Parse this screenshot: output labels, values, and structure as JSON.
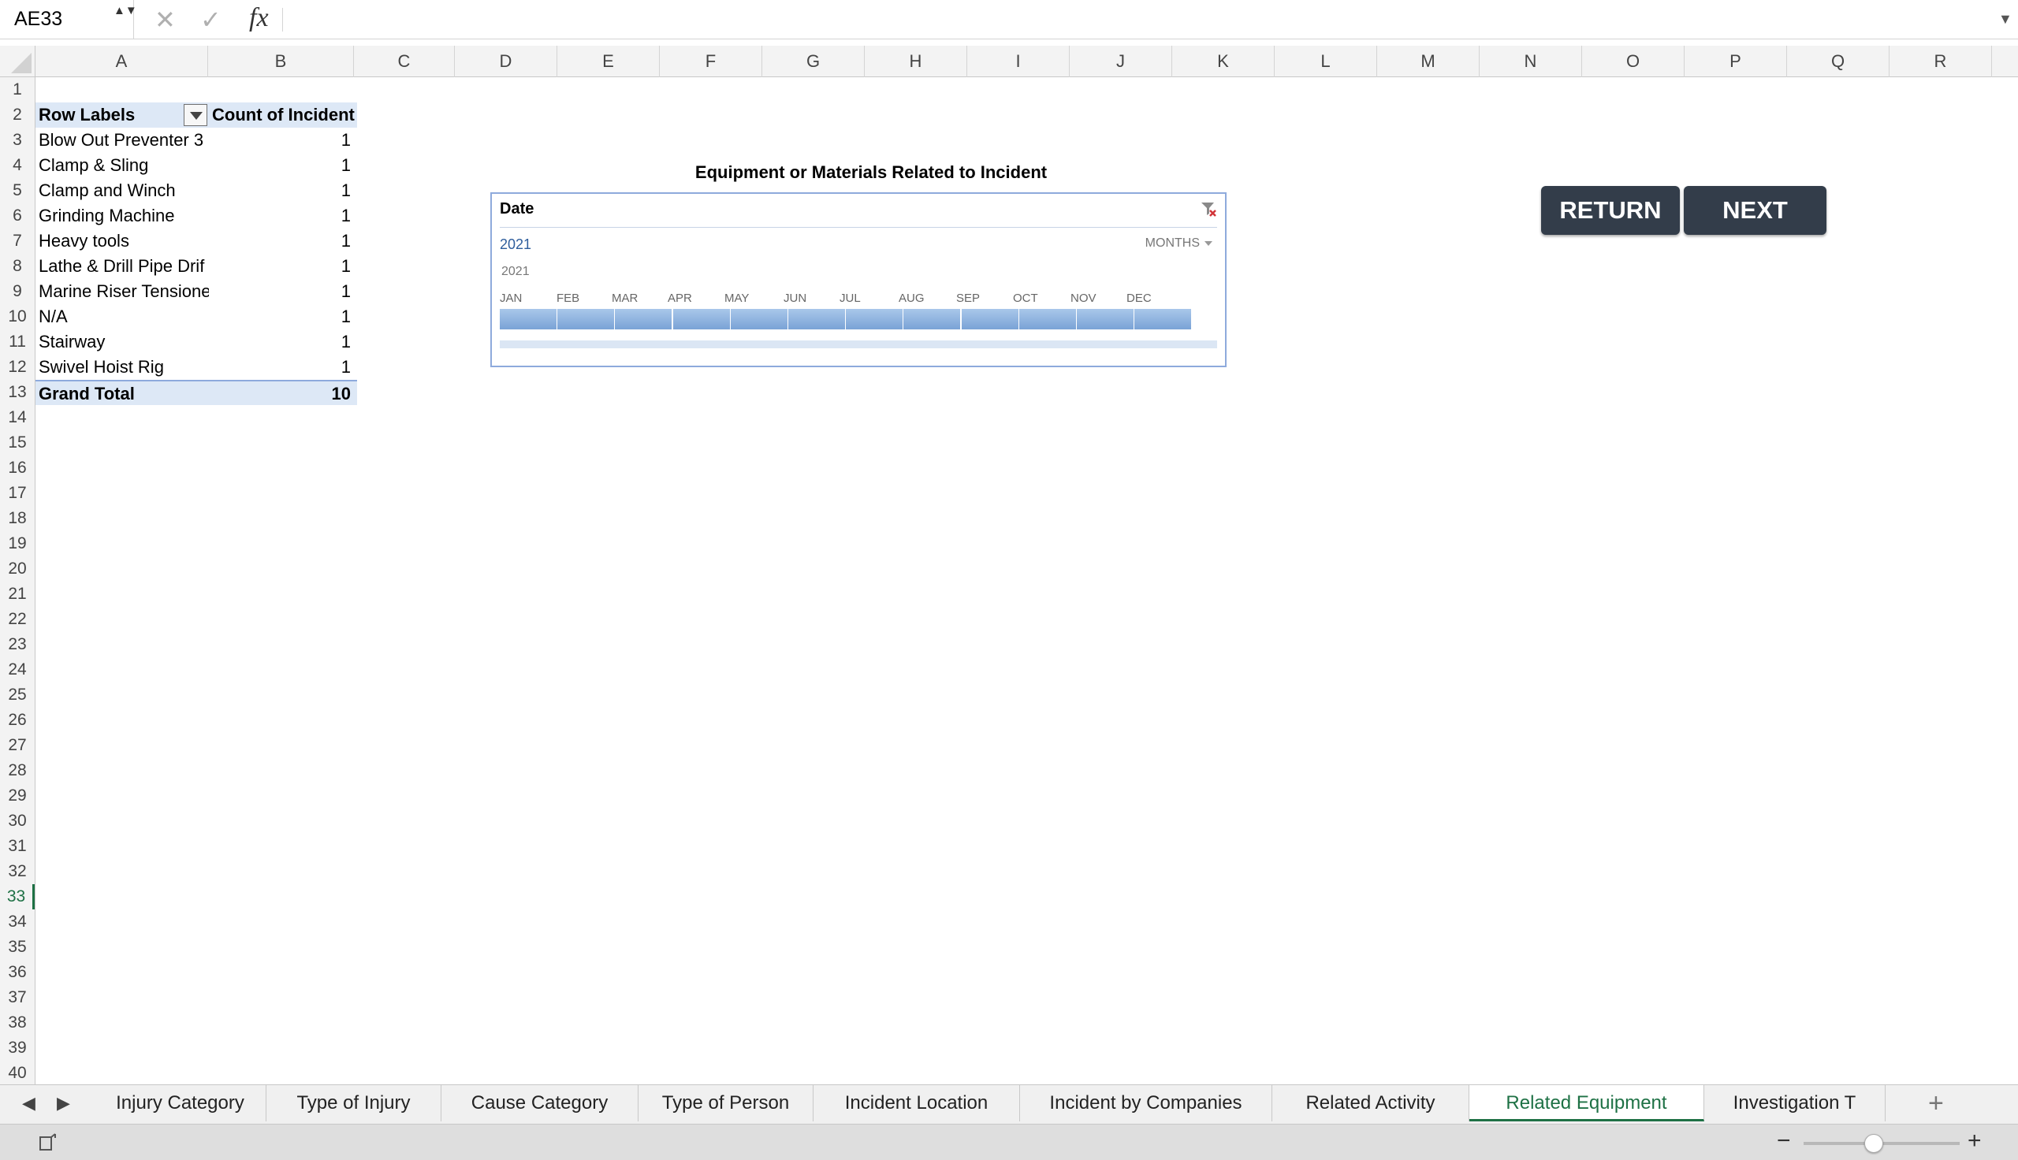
{
  "formula_bar": {
    "cell_reference": "AE33",
    "formula": "",
    "fx_label": "fx",
    "stepper_icon": "▲▼",
    "cancel_icon": "✕",
    "enter_icon": "✓",
    "expand_icon": "▼"
  },
  "columns": [
    "A",
    "B",
    "C",
    "D",
    "E",
    "F",
    "G",
    "H",
    "I",
    "J",
    "K",
    "L",
    "M",
    "N",
    "O",
    "P",
    "Q",
    "R"
  ],
  "rows": [
    "1",
    "2",
    "3",
    "4",
    "5",
    "6",
    "7",
    "8",
    "9",
    "10",
    "11",
    "12",
    "13",
    "14",
    "15",
    "16",
    "17",
    "18",
    "19",
    "20",
    "21",
    "22",
    "23",
    "24",
    "25",
    "26",
    "27",
    "28",
    "29",
    "30",
    "31",
    "32",
    "33",
    "34",
    "35",
    "36",
    "37",
    "38",
    "39",
    "40"
  ],
  "active_row": "33",
  "pivot": {
    "header_label": "Row Labels",
    "header_value": "Count of Incident",
    "items": [
      {
        "label": "Blow Out Preventer 3",
        "value": "1"
      },
      {
        "label": "Clamp & Sling",
        "value": "1"
      },
      {
        "label": "Clamp and Winch",
        "value": "1"
      },
      {
        "label": "Grinding Machine",
        "value": "1"
      },
      {
        "label": "Heavy tools",
        "value": "1"
      },
      {
        "label": "Lathe & Drill Pipe Drif",
        "value": "1"
      },
      {
        "label": "Marine Riser Tensione",
        "value": "1"
      },
      {
        "label": "N/A",
        "value": "1"
      },
      {
        "label": "Stairway",
        "value": "1"
      },
      {
        "label": "Swivel Hoist Rig",
        "value": "1"
      }
    ],
    "total_label": "Grand Total",
    "total_value": "10"
  },
  "chart_title": "Equipment or Materials Related to Incident",
  "timeline": {
    "header": "Date",
    "selected_period": "2021",
    "time_level": "MONTHS",
    "year_label": "2021",
    "months": [
      "JAN",
      "FEB",
      "MAR",
      "APR",
      "MAY",
      "JUN",
      "JUL",
      "AUG",
      "SEP",
      "OCT",
      "NOV",
      "DEC"
    ]
  },
  "buttons": {
    "return_label": "RETURN",
    "next_label": "NEXT"
  },
  "sheet_tabs": [
    {
      "label": "Injury Category",
      "active": false
    },
    {
      "label": "Type of Injury",
      "active": false
    },
    {
      "label": "Cause Category",
      "active": false
    },
    {
      "label": "Type of Person",
      "active": false
    },
    {
      "label": "Incident Location",
      "active": false
    },
    {
      "label": "Incident by Companies",
      "active": false
    },
    {
      "label": "Related Activity",
      "active": false
    },
    {
      "label": "Related Equipment",
      "active": true
    },
    {
      "label": "Investigation T",
      "active": false
    }
  ],
  "tab_nav": {
    "prev": "◀",
    "next": "▶",
    "add": "+"
  },
  "status_bar": {
    "zoom_minus": "−",
    "zoom_plus": "+",
    "zoom_level_fraction": 0.45
  },
  "colors": {
    "accent_green": "#1e7145",
    "button_dark": "#333d4a",
    "pivot_header_fill": "#dde8f6",
    "timeline_bar": "#7aa3d6"
  }
}
